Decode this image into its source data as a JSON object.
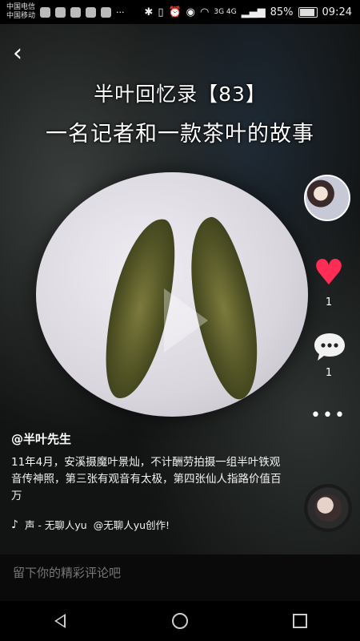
{
  "status_bar": {
    "carrier1": "中国电信",
    "carrier2": "中国移动",
    "network_labels": "3G 4G",
    "battery": "85%",
    "time": "09:24",
    "icons": [
      "telegram-icon",
      "app-icon",
      "tiktok-icon",
      "music-icon",
      "notification-icon"
    ]
  },
  "video": {
    "title_line1": "半叶回忆录【83】",
    "title_line2": "一名记者和一款茶叶的故事"
  },
  "actions": {
    "like_count": "1",
    "comment_count": "1",
    "more": "•••"
  },
  "caption": {
    "author": "@半叶先生",
    "description": "11年4月，安溪摄魔叶景灿，不计酬劳拍摄一组半叶铁观音传神照，第三张有观音有太极，第四张仙人指路价值百万",
    "music": "声 - 无聊人yu",
    "music_credit": "@无聊人yu创作!"
  },
  "comment_bar": {
    "placeholder": "留下你的精彩评论吧"
  },
  "colors": {
    "like": "#ff2d55",
    "background": "#0a0a0a"
  }
}
